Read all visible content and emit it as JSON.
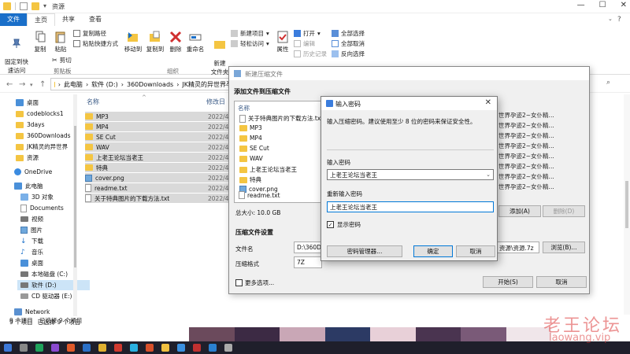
{
  "explorer": {
    "window_title": "资源",
    "tabs": [
      "文件",
      "主页",
      "共享",
      "查看"
    ],
    "ribbon": {
      "pin_label": "固定到快\n速访问",
      "copy_label": "复制",
      "paste_label": "粘贴",
      "copy_path": "复制路径",
      "paste_shortcut": "粘贴快捷方式",
      "cut": "剪切",
      "clipboard_group": "剪贴板",
      "move_to": "移动到",
      "copy_to": "复制到",
      "delete": "删除",
      "rename": "重命名",
      "organize_group": "组织",
      "new_folder": "新建\n文件夹",
      "new_item": "新建项目",
      "easy_access": "轻松访问",
      "properties": "属性",
      "open": "打开",
      "edit": "编辑",
      "history": "历史记录",
      "select_all": "全部选择",
      "select_none": "全部取消",
      "invert": "反向选择"
    },
    "address": [
      "此电脑",
      "软件 (D:)",
      "360Downloads",
      "JK精灵的异世界孕"
    ],
    "sidebar": [
      {
        "label": "桌面",
        "icon": "desktop-icon"
      },
      {
        "label": "codeblocks1",
        "icon": "folder-icon"
      },
      {
        "label": "3days",
        "icon": "folder-icon"
      },
      {
        "label": "360Downloads",
        "icon": "folder-icon"
      },
      {
        "label": "JK精灵的异世界",
        "icon": "folder-icon"
      },
      {
        "label": "资源",
        "icon": "folder-icon"
      },
      {
        "label": "OneDrive",
        "icon": "cloud-icon"
      },
      {
        "label": "此电脑",
        "icon": "computer-icon"
      },
      {
        "label": "3D 对象",
        "icon": "cube-icon"
      },
      {
        "label": "Documents",
        "icon": "documents-icon"
      },
      {
        "label": "视频",
        "icon": "video-icon"
      },
      {
        "label": "图片",
        "icon": "pictures-icon"
      },
      {
        "label": "下载",
        "icon": "download-icon"
      },
      {
        "label": "音乐",
        "icon": "music-icon"
      },
      {
        "label": "桌面",
        "icon": "desktop-icon"
      },
      {
        "label": "本地磁盘 (C:)",
        "icon": "drive-icon"
      },
      {
        "label": "软件 (D:)",
        "icon": "drive-icon"
      },
      {
        "label": "CD 驱动器 (E:)",
        "icon": "cd-icon"
      },
      {
        "label": "Network",
        "icon": "network-icon"
      }
    ],
    "columns": {
      "name": "名称",
      "date": "修改日"
    },
    "files": [
      {
        "name": "MP3",
        "date": "2022/4/",
        "type": "folder"
      },
      {
        "name": "MP4",
        "date": "2022/4/",
        "type": "folder"
      },
      {
        "name": "SE Cut",
        "date": "2022/4/",
        "type": "folder"
      },
      {
        "name": "WAV",
        "date": "2022/4/",
        "type": "folder"
      },
      {
        "name": "上老王论坛当老王",
        "date": "2022/4/",
        "type": "folder"
      },
      {
        "name": "特典",
        "date": "2022/4/",
        "type": "folder"
      },
      {
        "name": "cover.png",
        "date": "2022/4/",
        "type": "image"
      },
      {
        "name": "readme.txt",
        "date": "2022/4/",
        "type": "file"
      },
      {
        "name": "关于特典图片的下载方法.txt",
        "date": "2022/4/",
        "type": "file"
      }
    ],
    "status_count": "9 个项目",
    "status_selected": "已选择 9 个项目",
    "status_count2": "9 个项目",
    "status_selected2": "已选择 9 个项目"
  },
  "archive_dialog": {
    "title": "新建压缩文件",
    "add_section": "添加文件到压缩文件",
    "list_header": "名称",
    "items": [
      {
        "name": "关于特典图片的下载方法.txt",
        "type": "file"
      },
      {
        "name": "MP3",
        "type": "folder"
      },
      {
        "name": "MP4",
        "type": "folder"
      },
      {
        "name": "SE Cut",
        "type": "folder"
      },
      {
        "name": "WAV",
        "type": "folder"
      },
      {
        "name": "上老王论坛当老王",
        "type": "folder"
      },
      {
        "name": "特典",
        "type": "folder"
      },
      {
        "name": "cover.png",
        "type": "image"
      },
      {
        "name": "readme.txt",
        "type": "file"
      }
    ],
    "total_size": "总大小: 10.0 GB",
    "add_button": "添加(A)",
    "delete_button": "删除(D)",
    "settings_section": "压缩文件设置",
    "filename_label": "文件名",
    "filename_value": "D:\\360Do",
    "filename_tail": "资源\\资源.7z",
    "browse_button": "浏览(B)...",
    "format_label": "压缩格式",
    "format_value": "7Z",
    "more_options": "更多选项...",
    "start_button": "开始(S)",
    "cancel_button": "取消",
    "right_list": [
      "世界孕迹2~女仆精...",
      "世界孕迹2~女仆精...",
      "世界孕迹2~女仆精...",
      "世界孕迹2~女仆精...",
      "世界孕迹2~女仆精...",
      "世界孕迹2~女仆精...",
      "世界孕迹2~女仆精...",
      "世界孕迹2~女仆精..."
    ]
  },
  "password_dialog": {
    "title": "输入密码",
    "hint": "输入压缩密码。建议使用至少 8 位的密码来保证安全性。",
    "enter_label": "输入密码",
    "enter_value": "上老王论坛当老王",
    "reenter_label": "重新输入密码",
    "reenter_value": "上老王论坛当老王",
    "show_password": "显示密码",
    "show_checked": "✓",
    "manager_button": "密码管理器...",
    "ok_button": "确定",
    "cancel_button": "取消"
  },
  "watermark": {
    "text": "老王论坛",
    "url": "laowang.vip"
  },
  "colors": {
    "accent": "#1a6fc9",
    "selection": "#cce4f7",
    "folder": "#f4c542"
  }
}
